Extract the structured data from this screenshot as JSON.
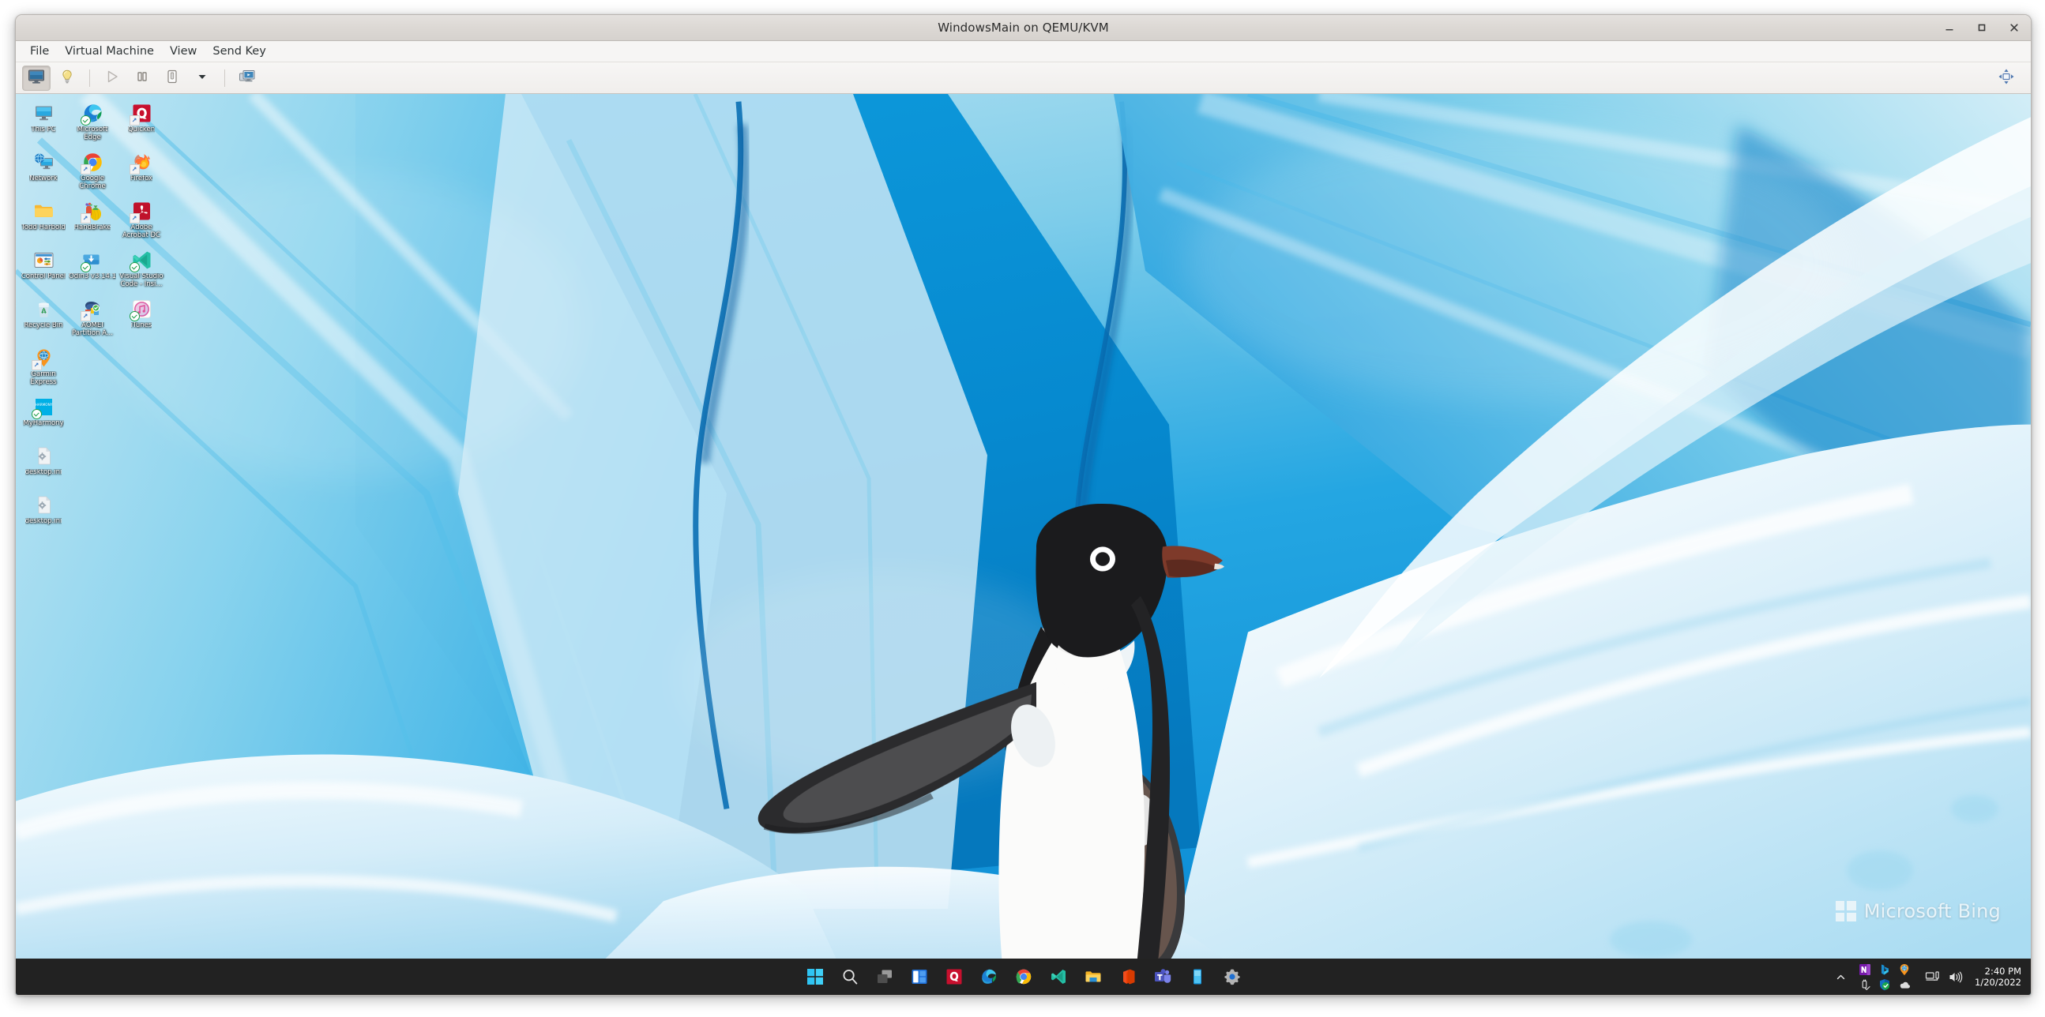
{
  "window": {
    "title": "WindowsMain on QEMU/KVM",
    "controls": [
      {
        "name": "minimize",
        "label": "—"
      },
      {
        "name": "maximize",
        "label": "□"
      },
      {
        "name": "close",
        "label": "✕"
      }
    ]
  },
  "menubar": {
    "items": [
      {
        "label": "File"
      },
      {
        "label": "Virtual Machine"
      },
      {
        "label": "View"
      },
      {
        "label": "Send Key"
      }
    ]
  },
  "toolbar": {
    "buttons": [
      {
        "name": "console-view",
        "icon": "monitor-icon",
        "state": "active"
      },
      {
        "name": "show-details",
        "icon": "lightbulb-icon",
        "state": "normal"
      },
      {
        "name": "run",
        "icon": "play-icon",
        "state": "disabled"
      },
      {
        "name": "pause",
        "icon": "pause-icon",
        "state": "normal"
      },
      {
        "name": "shutdown",
        "icon": "power-switch-icon",
        "state": "normal"
      },
      {
        "name": "shutdown-menu",
        "icon": "chevron-down-icon",
        "state": "normal"
      },
      {
        "name": "snapshots",
        "icon": "snapshots-icon",
        "state": "normal"
      },
      {
        "name": "fullscreen",
        "icon": "fullscreen-icon",
        "state": "normal"
      }
    ]
  },
  "desktop": {
    "icons": [
      {
        "label": "This PC",
        "icon": "this-pc-icon",
        "overlay": "none"
      },
      {
        "label": "Microsoft Edge",
        "icon": "edge-icon",
        "overlay": "check"
      },
      {
        "label": "Quicken",
        "icon": "quicken-icon",
        "overlay": "shortcut"
      },
      {
        "label": "Network",
        "icon": "network-icon",
        "overlay": "none"
      },
      {
        "label": "Google Chrome",
        "icon": "chrome-icon",
        "overlay": "shortcut"
      },
      {
        "label": "Firefox",
        "icon": "firefox-icon",
        "overlay": "shortcut"
      },
      {
        "label": "Todd Harbold",
        "icon": "folder-icon",
        "overlay": "none"
      },
      {
        "label": "HandBrake",
        "icon": "handbrake-icon",
        "overlay": "shortcut"
      },
      {
        "label": "Adobe Acrobat DC",
        "icon": "acrobat-icon",
        "overlay": "shortcut"
      },
      {
        "label": "Control Panel",
        "icon": "control-panel-icon",
        "overlay": "none"
      },
      {
        "label": "Odin3 v3.14.1",
        "icon": "odin-icon",
        "overlay": "check"
      },
      {
        "label": "Visual Studio Code - Insi...",
        "icon": "vscode-insiders-icon",
        "overlay": "check"
      },
      {
        "label": "Recycle Bin",
        "icon": "recycle-bin-icon",
        "overlay": "none"
      },
      {
        "label": "AOMEI Partition A...",
        "icon": "aomei-icon",
        "overlay": "shortcut"
      },
      {
        "label": "iTunes",
        "icon": "itunes-icon",
        "overlay": "check"
      },
      {
        "label": "Garmin Express",
        "icon": "garmin-express-icon",
        "overlay": "shortcut"
      },
      {
        "label": "MyHarmony",
        "icon": "myharmony-icon",
        "overlay": "check"
      },
      {
        "label": "desktop.ini",
        "icon": "ini-file-icon",
        "overlay": "none"
      },
      {
        "label": "desktop.ini",
        "icon": "ini-file-icon",
        "overlay": "none"
      }
    ],
    "watermark": "Microsoft Bing"
  },
  "taskbar": {
    "items": [
      {
        "name": "start-button",
        "icon": "windows-start-icon"
      },
      {
        "name": "search",
        "icon": "search-icon"
      },
      {
        "name": "task-view",
        "icon": "task-view-icon"
      },
      {
        "name": "widgets",
        "icon": "widgets-icon"
      },
      {
        "name": "quicken",
        "icon": "quicken-icon"
      },
      {
        "name": "microsoft-edge",
        "icon": "edge-icon"
      },
      {
        "name": "google-chrome",
        "icon": "chrome-icon"
      },
      {
        "name": "visual-studio-code",
        "icon": "vscode-icon"
      },
      {
        "name": "file-explorer",
        "icon": "folder-icon"
      },
      {
        "name": "microsoft-office",
        "icon": "office-icon"
      },
      {
        "name": "microsoft-teams",
        "icon": "teams-icon"
      },
      {
        "name": "your-phone",
        "icon": "phone-icon"
      },
      {
        "name": "settings",
        "icon": "gear-icon"
      }
    ],
    "tray": {
      "chevron": "show-hidden-icons",
      "icons": [
        {
          "name": "onenote",
          "icon": "onenote-icon"
        },
        {
          "name": "bing",
          "icon": "bing-icon"
        },
        {
          "name": "garmin",
          "icon": "garmin-icon"
        },
        {
          "name": "safely-remove-hardware",
          "icon": "usb-icon"
        },
        {
          "name": "windows-defender",
          "icon": "defender-shield-icon"
        },
        {
          "name": "onedrive",
          "icon": "onedrive-cloud-icon"
        }
      ],
      "status": [
        {
          "name": "network",
          "icon": "network-icon"
        },
        {
          "name": "volume",
          "icon": "speaker-icon"
        }
      ],
      "time": "2:40 PM",
      "date": "1/20/2022"
    }
  },
  "colors": {
    "taskbar_bg": "#222222",
    "window_chrome": "#f6f5f4",
    "titlebar": "#dcd8d4",
    "ice_cyan": "#1aa7e0",
    "ice_deep": "#0b7fc4",
    "snow": "#e9f5fb",
    "accent_blue": "#2b6fc4"
  }
}
